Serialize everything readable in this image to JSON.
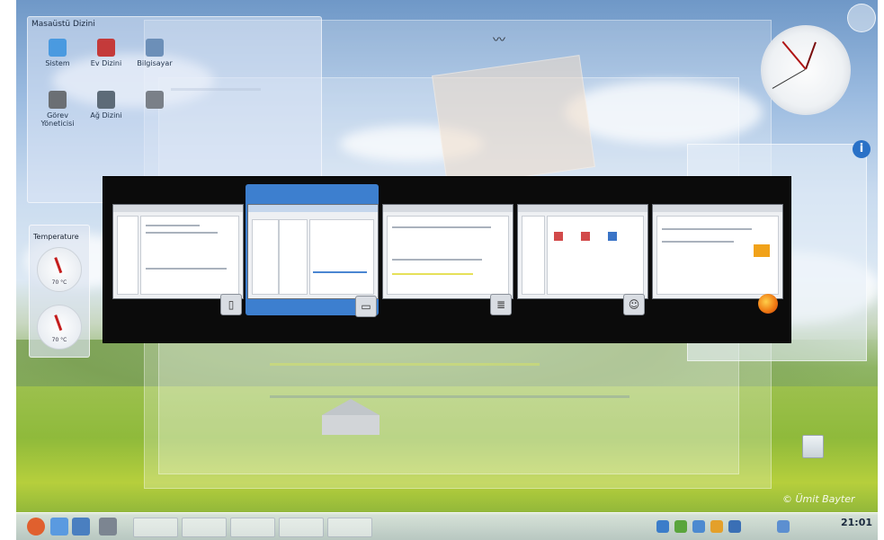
{
  "desktop": {
    "folder_view": {
      "title": "Masaüstü Dizini",
      "icons": [
        {
          "label": "Sistem",
          "icon": "monitor-icon",
          "color": "#4a9ae0"
        },
        {
          "label": "Ev Dizini",
          "icon": "home-icon",
          "color": "#c43a3a"
        },
        {
          "label": "Bilgisayar",
          "icon": "computer-icon",
          "color": "#6c8fb8"
        },
        {
          "label": "Görev\nYöneticisi",
          "icon": "task-manager-icon",
          "color": "#6b6f74"
        },
        {
          "label": "Ağ\nDizini",
          "icon": "network-icon",
          "color": "#5d6b78"
        },
        {
          "label": "",
          "icon": "file-icon",
          "color": "#7a8088"
        }
      ]
    },
    "temperature_widget": {
      "title": "Temperature",
      "gauges": [
        {
          "label": "70 °C",
          "name": "cpu-temperature-gauge"
        },
        {
          "label": "70 °C",
          "name": "gpu-temperature-gauge"
        }
      ]
    },
    "info_icon": "i",
    "watermark": "© Ümit Bayter"
  },
  "window_switcher": {
    "windows": [
      {
        "app_icon": "settings-app-icon",
        "selected": false,
        "badge": "▯"
      },
      {
        "app_icon": "file-manager-app-icon",
        "selected": true,
        "badge": "▭"
      },
      {
        "app_icon": "text-editor-app-icon",
        "selected": false,
        "badge": "≣"
      },
      {
        "app_icon": "user-app-icon",
        "selected": false,
        "badge": "☺"
      },
      {
        "app_icon": "firefox-icon",
        "selected": false,
        "badge": ""
      }
    ]
  },
  "taskbar": {
    "clock": "21:01",
    "launcher_icon": "kde-menu-icon",
    "tray_icons": [
      "network-icon",
      "volume-icon",
      "battery-icon",
      "clipboard-icon",
      "notification-icon"
    ]
  }
}
